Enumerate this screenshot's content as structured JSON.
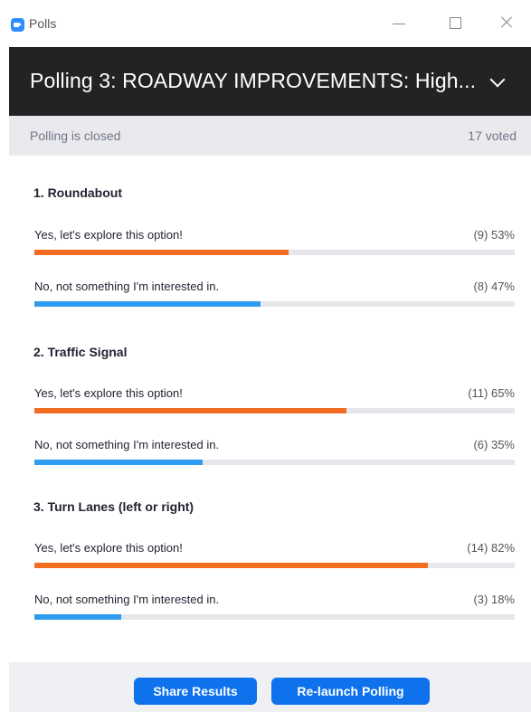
{
  "window": {
    "title": "Polls",
    "app_icon": "zoom-camera-icon"
  },
  "header": {
    "title": "Polling 3: ROADWAY IMPROVEMENTS: High...",
    "dropdown_icon": "chevron-down-icon"
  },
  "status": {
    "state": "Polling is closed",
    "votes": "17 voted"
  },
  "questions": [
    {
      "title": "1. Roundabout",
      "answers": [
        {
          "label": "Yes, let's explore this option!",
          "stat": "(9) 53%",
          "percent": 53,
          "color": "#f26d21"
        },
        {
          "label": "No, not something I'm interested in.",
          "stat": "(8) 47%",
          "percent": 47,
          "color": "#2d9bf0"
        }
      ]
    },
    {
      "title": "2. Traffic Signal",
      "answers": [
        {
          "label": "Yes, let's explore this option!",
          "stat": "(11) 65%",
          "percent": 65,
          "color": "#f26d21"
        },
        {
          "label": "No, not something I'm interested in.",
          "stat": "(6) 35%",
          "percent": 35,
          "color": "#2d9bf0"
        }
      ]
    },
    {
      "title": "3. Turn Lanes (left or right)",
      "answers": [
        {
          "label": "Yes, let's explore this option!",
          "stat": "(14) 82%",
          "percent": 82,
          "color": "#f26d21"
        },
        {
          "label": "No, not something I'm interested in.",
          "stat": "(3) 18%",
          "percent": 18,
          "color": "#2d9bf0"
        }
      ]
    }
  ],
  "footer": {
    "share_label": "Share Results",
    "relaunch_label": "Re-launch Polling"
  },
  "colors": {
    "yes": "#f26d21",
    "no": "#2d9bf0",
    "button": "#0e72ed",
    "header_bg": "#222324"
  }
}
